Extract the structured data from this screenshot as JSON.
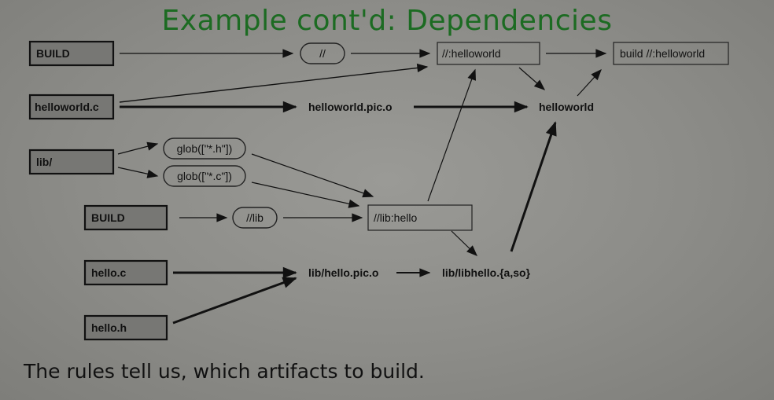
{
  "slide": {
    "title": "Example cont'd: Dependencies",
    "caption": "The rules tell us, which artifacts to build."
  },
  "nodes": {
    "build_root": "BUILD",
    "helloworld_c": "helloworld.c",
    "lib_dir": "lib/",
    "build_lib": "BUILD",
    "hello_c": "hello.c",
    "hello_h": "hello.h",
    "pkg_root": "//",
    "glob_h": "glob([\"*.h\"])",
    "glob_c": "glob([\"*.c\"])",
    "pkg_lib": "//lib",
    "target_helloworld": "//:helloworld",
    "build_helloworld": "build //:helloworld",
    "helloworld_pic_o": "helloworld.pic.o",
    "helloworld_bin": "helloworld",
    "target_lib_hello": "//lib:hello",
    "lib_hello_pic_o": "lib/hello.pic.o",
    "lib_libhello": "lib/libhello.{a,so}"
  },
  "colors": {
    "title": "#1c6b22",
    "background": "#8c8c88",
    "source_box_fill": "#777774"
  }
}
